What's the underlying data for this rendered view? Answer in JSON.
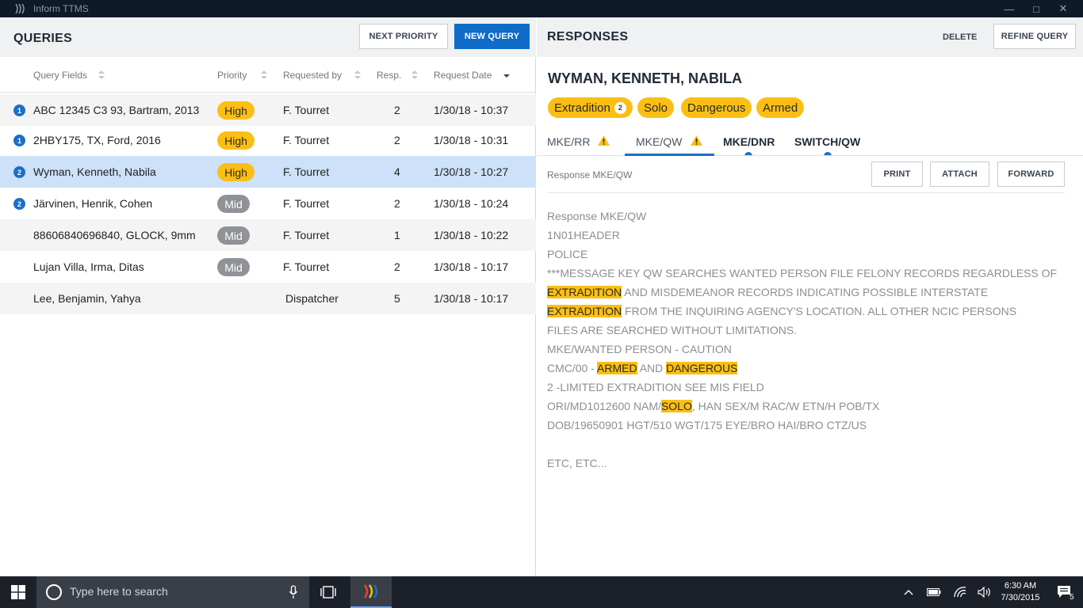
{
  "window": {
    "title": "Inform TTMS"
  },
  "queries": {
    "header": "QUERIES",
    "next_priority_label": "NEXT PRIORITY",
    "new_query_label": "NEW QUERY",
    "columns": {
      "fields": "Query Fields",
      "priority": "Priority",
      "requested_by": "Requested by",
      "resp": "Resp.",
      "date": "Request Date"
    },
    "rows": [
      {
        "badge": "1",
        "fields": "ABC 12345 C3 93, Bartram, 2013",
        "priority": "High",
        "requested_by": "F. Tourret",
        "resp": "2",
        "date": "1/30/18 - 10:37"
      },
      {
        "badge": "1",
        "fields": "2HBY175, TX, Ford, 2016",
        "priority": "High",
        "requested_by": "F. Tourret",
        "resp": "2",
        "date": "1/30/18 - 10:31"
      },
      {
        "badge": "2",
        "fields": "Wyman, Kenneth, Nabila",
        "priority": "High",
        "requested_by": "F. Tourret",
        "resp": "4",
        "date": "1/30/18 - 10:27"
      },
      {
        "badge": "2",
        "fields": "Järvinen, Henrik, Cohen",
        "priority": "Mid",
        "requested_by": "F. Tourret",
        "resp": "2",
        "date": "1/30/18 - 10:24"
      },
      {
        "badge": "",
        "fields": "88606840696840, GLOCK, 9mm",
        "priority": "Mid",
        "requested_by": "F. Tourret",
        "resp": "1",
        "date": "1/30/18 - 10:22"
      },
      {
        "badge": "",
        "fields": "Lujan Villa, Irma, Ditas",
        "priority": "Mid",
        "requested_by": "F. Tourret",
        "resp": "2",
        "date": "1/30/18 - 10:17"
      },
      {
        "badge": "",
        "fields": "Lee, Benjamin, Yahya",
        "priority": "",
        "requested_by": "Dispatcher",
        "resp": "5",
        "date": "1/30/18 - 10:17"
      }
    ]
  },
  "responses": {
    "header": "RESPONSES",
    "delete_label": "DELETE",
    "refine_label": "REFINE QUERY",
    "subject": "WYMAN, KENNETH, NABILA",
    "tags": [
      {
        "label": "Extradition",
        "count": "2"
      },
      {
        "label": "Solo"
      },
      {
        "label": "Dangerous"
      },
      {
        "label": "Armed"
      }
    ],
    "tabs": [
      "MKE/RR",
      "MKE/QW",
      "MKE/DNR",
      "SWITCH/QW"
    ],
    "response_label": "Response MKE/QW",
    "print_label": "PRINT",
    "attach_label": "ATTACH",
    "forward_label": "FORWARD",
    "body": {
      "l1": "Response MKE/QW",
      "l2": "1N01HEADER",
      "l3": "POLICE",
      "l4": "***MESSAGE KEY QW SEARCHES WANTED PERSON FILE FELONY RECORDS REGARDLESS OF",
      "l5a": "EXTRADITION",
      "l5b": " AND MISDEMEANOR RECORDS INDICATING POSSIBLE INTERSTATE",
      "l6a": "EXTRADITION",
      "l6b": " FROM THE INQUIRING AGENCY'S LOCATION. ALL OTHER NCIC PERSONS",
      "l7": "FILES ARE SEARCHED WITHOUT LIMITATIONS.",
      "l8": "MKE/WANTED PERSON - CAUTION",
      "l9a": "CMC/00 - ",
      "l9b": "ARMED",
      "l9c": " AND ",
      "l9d": "DANGEROUS",
      "l10": "2 -LIMITED EXTRADITION SEE MIS FIELD",
      "l11a": "ORI/MD1012600 NAM/",
      "l11b": "SOLO",
      "l11c": ", HAN SEX/M RAC/W ETN/H POB/TX",
      "l12": "DOB/19650901 HGT/510 WGT/175 EYE/BRO HAI/BRO CTZ/US",
      "l13": "ETC, ETC..."
    }
  },
  "taskbar": {
    "search_placeholder": "Type here to search",
    "time": "6:30 AM",
    "date": "7/30/2015",
    "notifications": "5"
  },
  "colors": {
    "accent": "#0f6bc8",
    "high": "#fbbf14",
    "mid": "#8f9296",
    "selected_row": "#cde1f8"
  }
}
